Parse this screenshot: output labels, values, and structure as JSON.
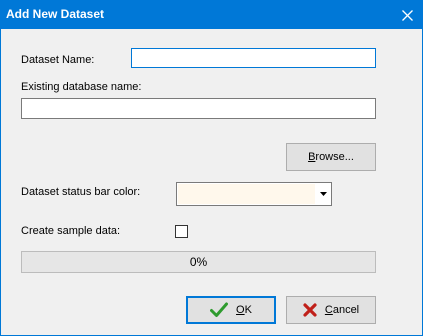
{
  "window": {
    "title": "Add New Dataset",
    "close_icon": "close-icon",
    "accent_color": "#0078d7"
  },
  "form": {
    "dataset_name": {
      "label": "Dataset Name:",
      "value": ""
    },
    "existing_database": {
      "label": "Existing database name:",
      "value": ""
    },
    "browse_button": {
      "label_before": "",
      "label_accel": "B",
      "label_after": "rowse..."
    },
    "status_bar_color": {
      "label": "Dataset status bar color:",
      "selected_color": "#fff8ec",
      "dropdown_icon": "chevron-down-icon"
    },
    "create_sample_data": {
      "label": "Create sample data:",
      "checked": false
    },
    "progress": {
      "value": 0,
      "text": "0%"
    }
  },
  "buttons": {
    "ok": {
      "label_before": "",
      "label_accel": "O",
      "label_after": "K",
      "icon": "checkmark-icon",
      "icon_color": "#2e9b2e"
    },
    "cancel": {
      "label_before": "",
      "label_accel": "C",
      "label_after": "ancel",
      "icon": "x-cross-icon",
      "icon_color": "#c0201a"
    }
  }
}
